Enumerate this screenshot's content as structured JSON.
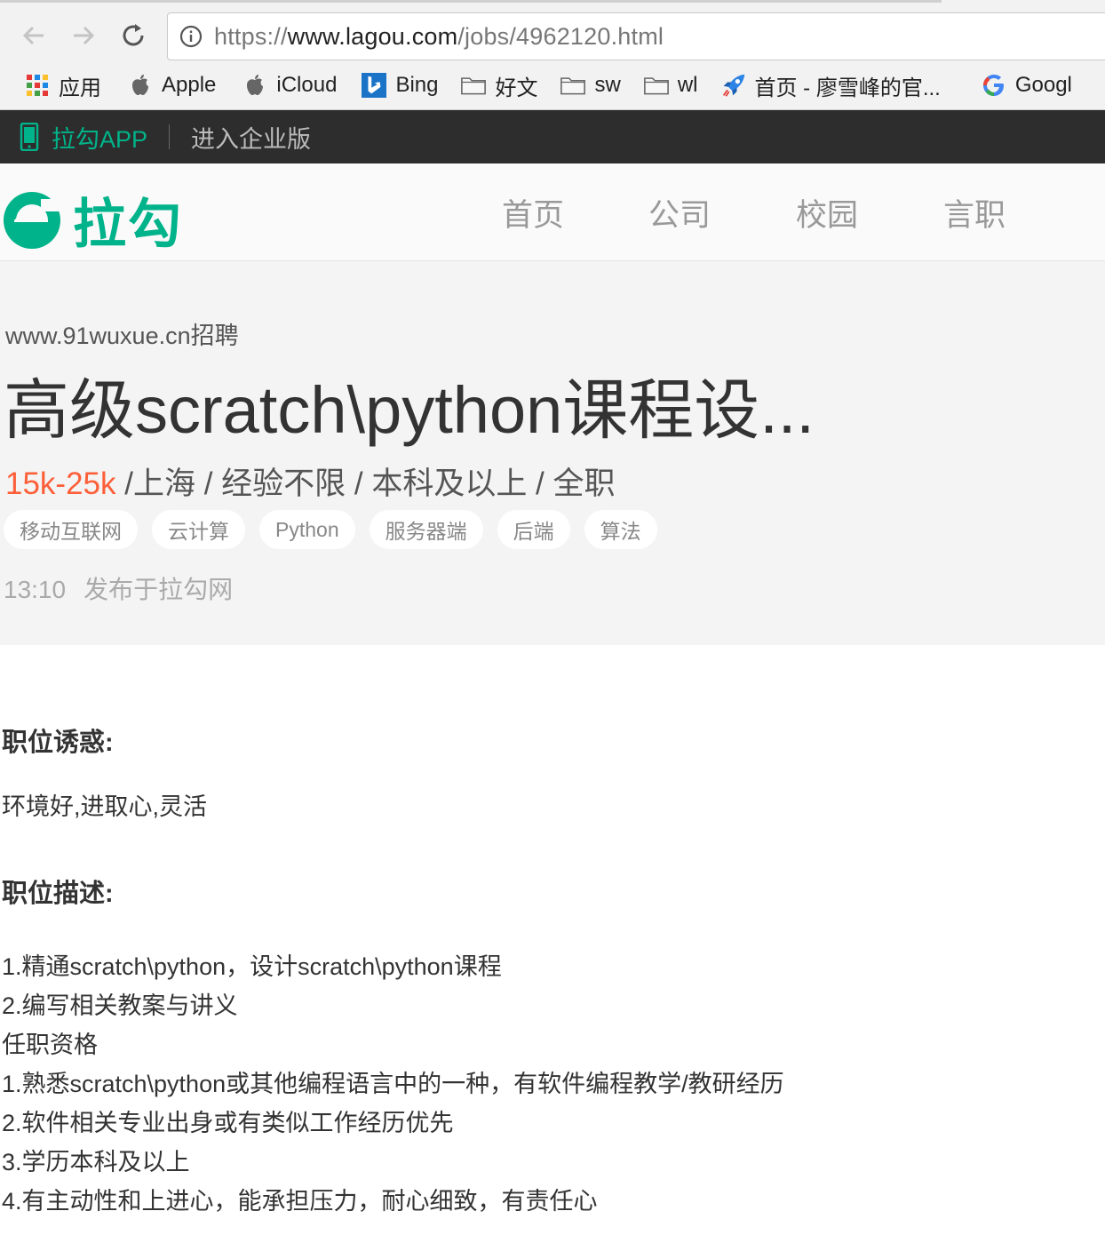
{
  "browser": {
    "url_scheme": "https://",
    "url_host": "www.lagou.com",
    "url_path": "/jobs/4962120.html",
    "bookmarks": [
      {
        "label": "应用",
        "icon": "apps-grid-icon"
      },
      {
        "label": "Apple",
        "icon": "apple-icon"
      },
      {
        "label": "iCloud",
        "icon": "apple-icon"
      },
      {
        "label": "Bing",
        "icon": "bing-icon"
      },
      {
        "label": "好文",
        "icon": "folder-icon"
      },
      {
        "label": "sw",
        "icon": "folder-icon"
      },
      {
        "label": "wl",
        "icon": "folder-icon"
      },
      {
        "label": "首页 - 廖雪峰的官...",
        "icon": "rocket-icon"
      },
      {
        "label": "Googl",
        "icon": "google-icon"
      }
    ]
  },
  "topbar": {
    "app_label": "拉勾APP",
    "enterprise_label": "进入企业版"
  },
  "header": {
    "logo_text": "拉勾",
    "nav": [
      "首页",
      "公司",
      "校园",
      "言职"
    ],
    "brand_color": "#00b38a"
  },
  "job": {
    "company": "www.91wuxue.cn招聘",
    "title": "高级scratch\\python课程设...",
    "salary": "15k-25k",
    "meta_rest": " /上海 / 经验不限 / 本科及以上 / 全职",
    "tags": [
      "移动互联网",
      "云计算",
      "Python",
      "服务器端",
      "后端",
      "算法"
    ],
    "posted_time": "13:10",
    "posted_text": "发布于拉勾网",
    "salary_color": "#fd5f39"
  },
  "content": {
    "temptation_heading": "职位诱惑:",
    "temptation_text": "环境好,进取心,灵活",
    "desc_heading": "职位描述:",
    "desc_lines": [
      "1.精通scratch\\python，设计scratch\\python课程",
      "2.编写相关教案与讲义",
      "任职资格",
      "1.熟悉scratch\\python或其他编程语言中的一种，有软件编程教学/教研经历",
      "2.软件相关专业出身或有类似工作经历优先",
      "3.学历本科及以上",
      "4.有主动性和上进心，能承担压力，耐心细致，有责任心"
    ]
  }
}
